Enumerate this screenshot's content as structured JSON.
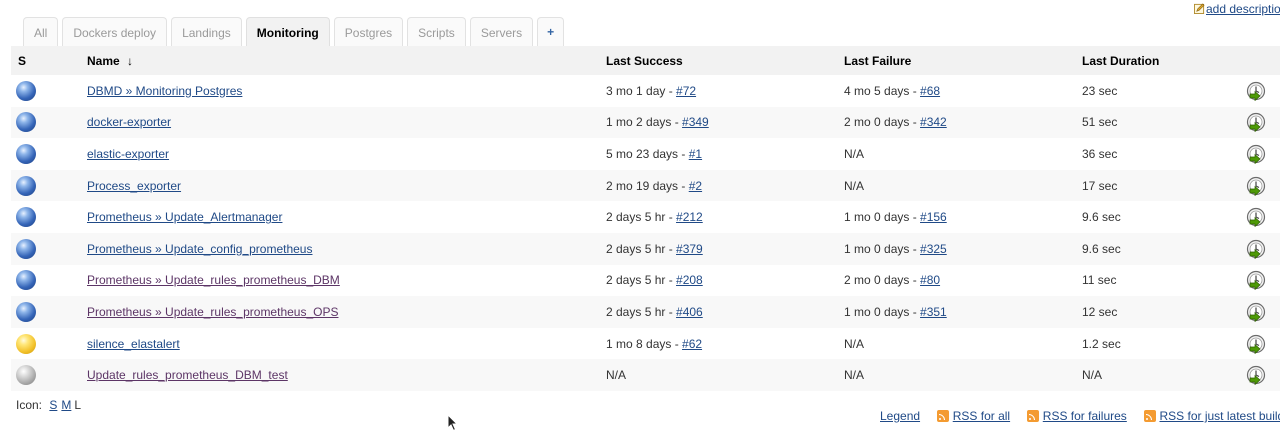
{
  "header": {
    "add_description": "add descriptio"
  },
  "tabs": [
    {
      "label": "All"
    },
    {
      "label": "Dockers deploy"
    },
    {
      "label": "Landings"
    },
    {
      "label": "Monitoring",
      "active": true
    },
    {
      "label": "Postgres"
    },
    {
      "label": "Scripts"
    },
    {
      "label": "Servers"
    },
    {
      "label": "+"
    }
  ],
  "table": {
    "headers": {
      "status": "S",
      "name": "Name",
      "sort_indicator": "↓",
      "last_success": "Last Success",
      "last_failure": "Last Failure",
      "last_duration": "Last Duration"
    },
    "rows": [
      {
        "status": "blue",
        "name": "DBMD » Monitoring Postgres",
        "success_time": "3 mo 1 day - ",
        "success_build": "#72",
        "failure_time": "4 mo 5 days - ",
        "failure_build": "#68",
        "duration": "23 sec"
      },
      {
        "status": "blue",
        "name": "docker-exporter",
        "success_time": "1 mo 2 days - ",
        "success_build": "#349",
        "failure_time": "2 mo 0 days - ",
        "failure_build": "#342",
        "duration": "51 sec"
      },
      {
        "status": "blue",
        "name": "elastic-exporter",
        "success_time": "5 mo 23 days - ",
        "success_build": "#1",
        "failure_time": "N/A",
        "failure_build": "",
        "duration": "36 sec"
      },
      {
        "status": "blue",
        "name": "Process_exporter",
        "success_time": "2 mo 19 days - ",
        "success_build": "#2",
        "failure_time": "N/A",
        "failure_build": "",
        "duration": "17 sec"
      },
      {
        "status": "blue",
        "name": "Prometheus » Update_Alertmanager",
        "success_time": "2 days 5 hr - ",
        "success_build": "#212",
        "failure_time": "1 mo 0 days - ",
        "failure_build": "#156",
        "duration": "9.6 sec"
      },
      {
        "status": "blue",
        "name": "Prometheus » Update_config_prometheus",
        "success_time": "2 days 5 hr - ",
        "success_build": "#379",
        "failure_time": "1 mo 0 days - ",
        "failure_build": "#325",
        "duration": "9.6 sec"
      },
      {
        "status": "blue",
        "name": "Prometheus » Update_rules_prometheus_DBM",
        "success_time": "2 days 5 hr - ",
        "success_build": "#208",
        "failure_time": "2 mo 0 days - ",
        "failure_build": "#80",
        "duration": "11 sec"
      },
      {
        "status": "blue",
        "name": "Prometheus » Update_rules_prometheus_OPS",
        "success_time": "2 days 5 hr - ",
        "success_build": "#406",
        "failure_time": "1 mo 0 days - ",
        "failure_build": "#351",
        "duration": "12 sec"
      },
      {
        "status": "yellow",
        "name": "silence_elastalert",
        "success_time": "1 mo 8 days - ",
        "success_build": "#62",
        "failure_time": "N/A",
        "failure_build": "",
        "duration": "1.2 sec"
      },
      {
        "status": "grey",
        "name": "Update_rules_prometheus_DBM_test",
        "success_time": "N/A",
        "success_build": "",
        "failure_time": "N/A",
        "failure_build": "",
        "duration": "N/A"
      }
    ]
  },
  "footer": {
    "icon_label": "Icon:",
    "icon_sizes": [
      "S",
      "M",
      "L"
    ],
    "legend": "Legend",
    "rss_all": "RSS for all",
    "rss_failures": "RSS for failures",
    "rss_latest": "RSS for just latest builds"
  },
  "colors": {
    "link": "#204a87",
    "visited_link": "#5c3566",
    "status_blue": "#3565b8",
    "status_yellow": "#f2c12a",
    "status_grey": "#a8a8a8",
    "rss_orange": "#f49b31"
  },
  "icons": {
    "edit": "edit-icon",
    "status_ball": "status-ball-icon",
    "schedule_build": "schedule-build-icon",
    "rss": "rss-icon"
  }
}
